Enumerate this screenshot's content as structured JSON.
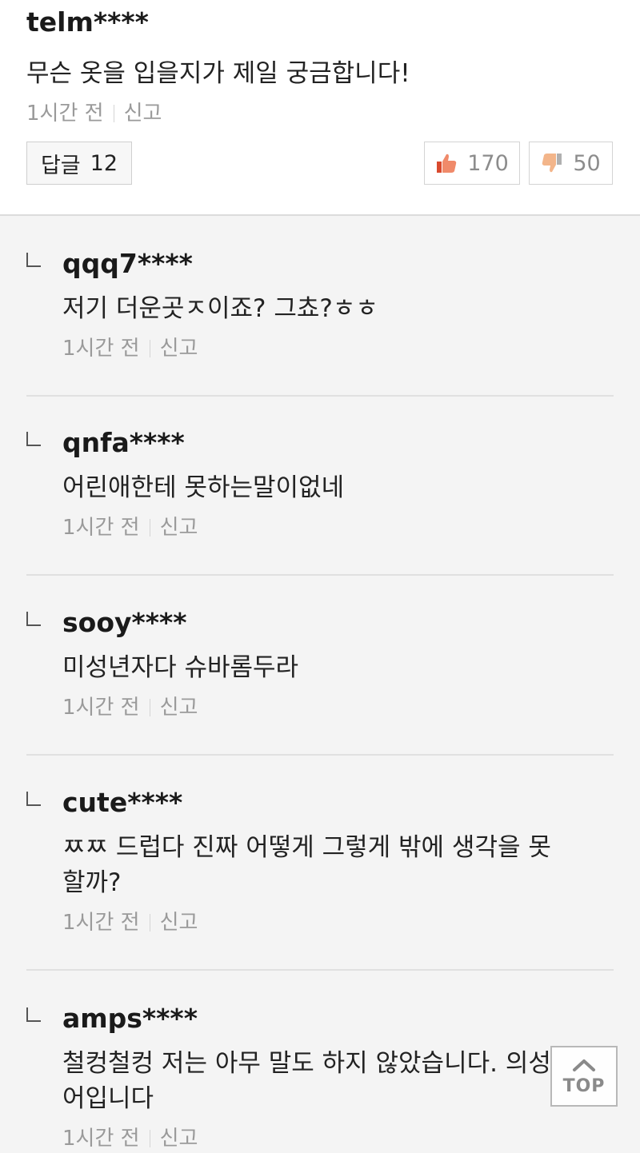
{
  "top_comment": {
    "username": "telm****",
    "content": "무슨 옷을 입을지가 제일 궁금합니다!",
    "time": "1시간 전",
    "report": "신고",
    "reply_label": "답글",
    "reply_count": "12",
    "likes": "170",
    "dislikes": "50"
  },
  "replies": [
    {
      "username": "qqq7****",
      "content": "저기 더운곳ㅈ이죠? 그쵸?ㅎㅎ",
      "time": "1시간 전",
      "report": "신고"
    },
    {
      "username": "qnfa****",
      "content": "어린애한테 못하는말이없네",
      "time": "1시간 전",
      "report": "신고"
    },
    {
      "username": "sooy****",
      "content": "미성년자다 슈바롬두라",
      "time": "1시간 전",
      "report": "신고"
    },
    {
      "username": "cute****",
      "content_line1": "ㅉㅉ 드럽다 진짜 어떻게 그렇게 밖에 생각을 못",
      "content_line2": "할까?",
      "time": "1시간 전",
      "report": "신고"
    },
    {
      "username": "amps****",
      "content_line1": "철컹철컹 저는 아무 말도 하지 않았습니다. 의성",
      "content_line2": "어입니다",
      "time": "1시간 전",
      "report": "신고"
    }
  ],
  "top_button": "TOP",
  "icons": {
    "like": "thumbs-up-icon",
    "dislike": "thumbs-down-icon",
    "reply_marker": "reply-corner-icon",
    "top": "chevron-up-icon"
  },
  "colors": {
    "like_icon": "#e8593c",
    "dislike_icon": "#f0a070",
    "divider": "#e0e0e0",
    "background": "#f4f4f4"
  }
}
